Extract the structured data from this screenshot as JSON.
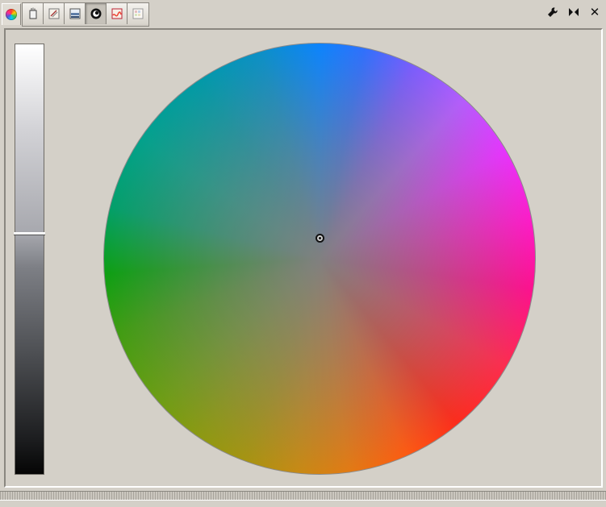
{
  "window": {
    "kind": "color-picker-panel"
  },
  "tabbar": {
    "panel_icon": "color-wheel-icon",
    "tools": [
      {
        "name": "tool-sliders",
        "icon": "pencil-cup-icon",
        "active": false
      },
      {
        "name": "tool-palette",
        "icon": "brush-palette-icon",
        "active": false
      },
      {
        "name": "tool-scale",
        "icon": "scale-picker-icon",
        "active": false
      },
      {
        "name": "tool-watercolor",
        "icon": "watercolor-icon",
        "active": true
      },
      {
        "name": "tool-wave",
        "icon": "wave-icon",
        "active": false
      },
      {
        "name": "tool-swatches",
        "icon": "swatches-icon",
        "active": false
      }
    ],
    "right_icons": [
      {
        "name": "configure-icon",
        "glyph": "🔧"
      },
      {
        "name": "detach-icon",
        "glyph": "⇄"
      },
      {
        "name": "close-icon",
        "glyph": "✕"
      }
    ]
  },
  "value_slider": {
    "value": 0.44
  },
  "color_wheel": {
    "cursor_x": 0.5,
    "cursor_y": 0.452
  },
  "colors": {
    "panel_bg": "#d4d0c8",
    "border_dark": "#8a8780",
    "accent_active": "#c6c2ba"
  }
}
